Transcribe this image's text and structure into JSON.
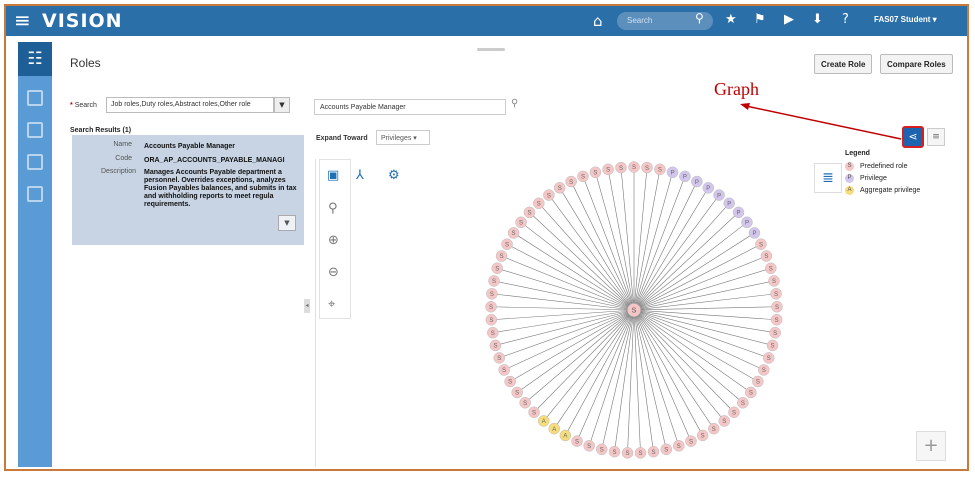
{
  "topbar": {
    "menu_icon": "hamburger-icon",
    "brand": "VISION",
    "search_placeholder": "Search",
    "user": "FAS07 Student ▾",
    "icons": [
      "home-icon",
      "search-icon",
      "star-icon",
      "flag-icon",
      "play-icon",
      "download-icon",
      "help-icon"
    ]
  },
  "page": {
    "title": "Roles",
    "buttons": {
      "create_role": "Create Role",
      "compare_roles": "Compare Roles"
    },
    "search": {
      "label": "Search",
      "required_mark": "*",
      "value": "Job roles,Duty roles,Abstract roles,Other role",
      "results_header": "Search Results (1)"
    },
    "result": {
      "name_label": "Name",
      "name": "Accounts Payable Manager",
      "code_label": "Code",
      "code": "ORA_AP_ACCOUNTS_PAYABLE_MANAGI",
      "description_label": "Description",
      "description": "Manages Accounts Payable department a personnel. Overrides exceptions, analyzes Fusion Payables balances, and submits in tax and withholding reports to meet regula requirements."
    },
    "role_input": "Accounts Payable Manager",
    "expand_toward_label": "Expand Toward",
    "expand_toward_value": "Privileges ▾"
  },
  "legend": {
    "title": "Legend",
    "items": [
      {
        "letter": "S",
        "label": "Predefined role",
        "color": "#f4c6c6"
      },
      {
        "letter": "P",
        "label": "Privilege",
        "color": "#d2c6ec"
      },
      {
        "letter": "A",
        "label": "Aggregate privilege",
        "color": "#f6dc7c"
      }
    ]
  },
  "annotation": {
    "text": "Graph",
    "color": "#c00000"
  },
  "colors": {
    "brand_bar": "#2a6fa8",
    "left_rail": "#5b9bd5",
    "graph_button": "#1e63b0",
    "role_node": "#f4c6c6",
    "privilege_node": "#d2c6ec",
    "aggregate_node": "#f6dc7c"
  },
  "graph": {
    "center_label": "S",
    "nodes": [
      "S",
      "S",
      "S",
      "P",
      "P",
      "P",
      "P",
      "P",
      "P",
      "P",
      "P",
      "P",
      "S",
      "S",
      "S",
      "S",
      "S",
      "S",
      "S",
      "S",
      "S",
      "S",
      "S",
      "S",
      "S",
      "S",
      "S",
      "S",
      "S",
      "S",
      "S",
      "S",
      "S",
      "S",
      "S",
      "S",
      "S",
      "S",
      "S",
      "S",
      "A",
      "A",
      "A",
      "S",
      "S",
      "S",
      "S",
      "S",
      "S",
      "S",
      "S",
      "S",
      "S",
      "S",
      "S",
      "S",
      "S",
      "S",
      "S",
      "S",
      "S",
      "S",
      "S",
      "S",
      "S",
      "S",
      "S",
      "S",
      "S"
    ]
  }
}
